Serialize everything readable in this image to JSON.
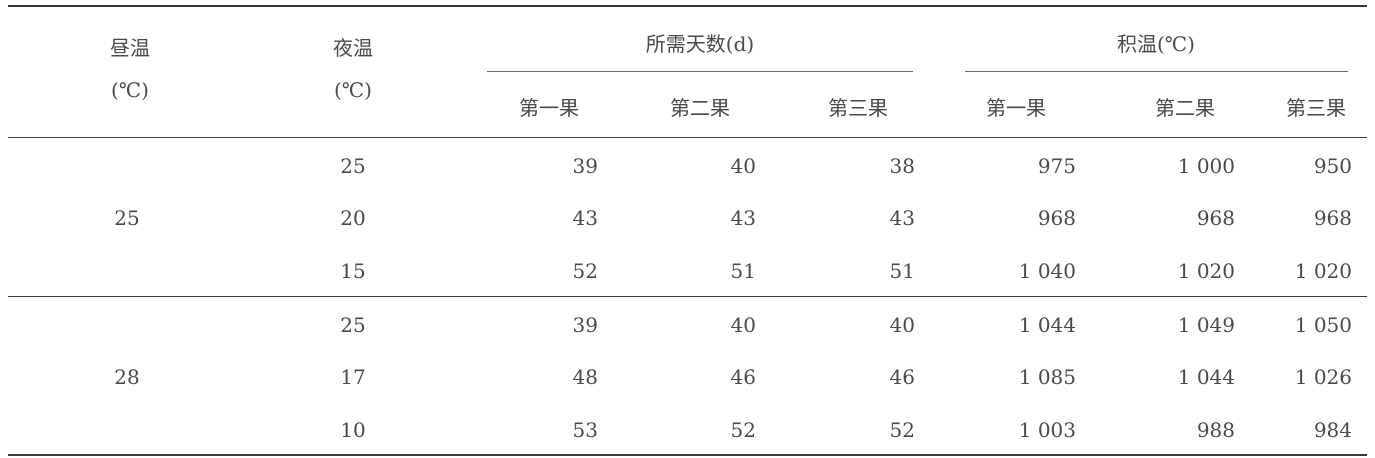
{
  "header": {
    "day_temp": "昼温",
    "day_temp_unit": "(℃)",
    "night_temp": "夜温",
    "night_temp_unit": "(℃)",
    "days_group": "所需天数(d)",
    "accum_group": "积温(℃)",
    "sub": [
      "第一果",
      "第二果",
      "第三果",
      "第一果",
      "第二果",
      "第三果"
    ]
  },
  "groups": [
    {
      "day": "25",
      "rows": [
        {
          "night": "25",
          "values": [
            "39",
            "40",
            "38",
            "975",
            "1 000",
            "950"
          ]
        },
        {
          "night": "20",
          "values": [
            "43",
            "43",
            "43",
            "968",
            "968",
            "968"
          ]
        },
        {
          "night": "15",
          "values": [
            "52",
            "51",
            "51",
            "1 040",
            "1 020",
            "1 020"
          ]
        }
      ]
    },
    {
      "day": "28",
      "rows": [
        {
          "night": "25",
          "values": [
            "39",
            "40",
            "40",
            "1 044",
            "1 049",
            "1 050"
          ]
        },
        {
          "night": "17",
          "values": [
            "48",
            "46",
            "46",
            "1 085",
            "1 044",
            "1 026"
          ]
        },
        {
          "night": "10",
          "values": [
            "53",
            "52",
            "52",
            "1 003",
            "988",
            "984"
          ]
        }
      ]
    }
  ]
}
